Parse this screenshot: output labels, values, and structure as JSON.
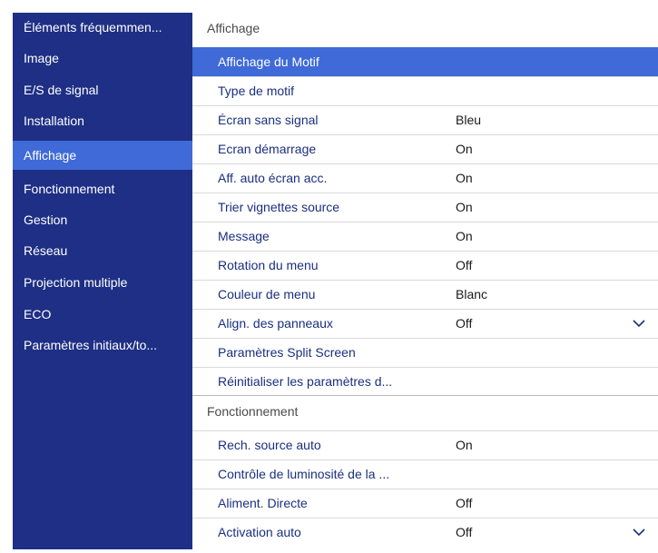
{
  "sidebar": {
    "items": [
      {
        "label": "Éléments fréquemmen..."
      },
      {
        "label": "Image"
      },
      {
        "label": "E/S de signal"
      },
      {
        "label": "Installation"
      },
      {
        "label": "Affichage"
      },
      {
        "label": "Fonctionnement"
      },
      {
        "label": "Gestion"
      },
      {
        "label": "Réseau"
      },
      {
        "label": "Projection multiple"
      },
      {
        "label": "ECO"
      },
      {
        "label": "Paramètres initiaux/to..."
      }
    ],
    "selected_index": 4
  },
  "sections": [
    {
      "title": "Affichage",
      "rows": [
        {
          "label": "Affichage du Motif",
          "value": ""
        },
        {
          "label": "Type de motif",
          "value": ""
        },
        {
          "label": "Écran sans signal",
          "value": "Bleu"
        },
        {
          "label": "Ecran démarrage",
          "value": "On"
        },
        {
          "label": "Aff. auto écran acc.",
          "value": "On"
        },
        {
          "label": "Trier vignettes source",
          "value": "On"
        },
        {
          "label": "Message",
          "value": "On"
        },
        {
          "label": "Rotation du menu",
          "value": "Off"
        },
        {
          "label": "Couleur de menu",
          "value": "Blanc"
        },
        {
          "label": "Align. des panneaux",
          "value": "Off"
        },
        {
          "label": "Paramètres Split Screen",
          "value": ""
        },
        {
          "label": "Réinitialiser les paramètres d...",
          "value": ""
        }
      ]
    },
    {
      "title": "Fonctionnement",
      "rows": [
        {
          "label": "Rech. source auto",
          "value": "On"
        },
        {
          "label": "Contrôle de luminosité de la ...",
          "value": ""
        },
        {
          "label": "Aliment. Directe",
          "value": "Off"
        },
        {
          "label": "Activation auto",
          "value": "Off"
        }
      ]
    }
  ],
  "colors": {
    "sidebar_bg": "#1e2f85",
    "selection": "#3f6ad8",
    "row_text": "#1a2f80"
  },
  "icons": {
    "dropdown": "chevron-down-icon"
  }
}
